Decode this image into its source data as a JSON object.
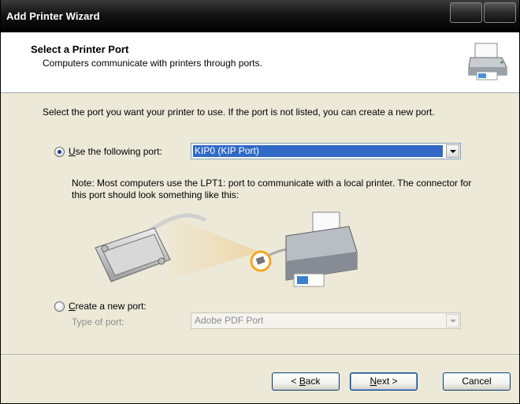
{
  "window": {
    "title": "Add Printer Wizard"
  },
  "header": {
    "title": "Select a Printer Port",
    "subtitle": "Computers communicate with printers through ports."
  },
  "content": {
    "intro": "Select the port you want your printer to use.  If the port is not listed, you can create a new port.",
    "use_port": {
      "label_u": "U",
      "label_rest": "se the following port:",
      "selected": true,
      "value": "KIP0 (KIP Port)"
    },
    "note": "Note: Most computers use the LPT1: port to communicate with a local printer. The connector for this port should look something like this:",
    "create_port": {
      "label_u": "C",
      "label_rest": "reate a new port:",
      "selected": false,
      "type_label": "Type of port:",
      "type_value": "Adobe PDF Port"
    }
  },
  "buttons": {
    "back_prefix": "< ",
    "back_u": "B",
    "back_rest": "ack",
    "next_u": "N",
    "next_rest": "ext >",
    "cancel": "Cancel"
  },
  "colors": {
    "selection": "#316ac5",
    "accent_ring": "#f5a623"
  }
}
